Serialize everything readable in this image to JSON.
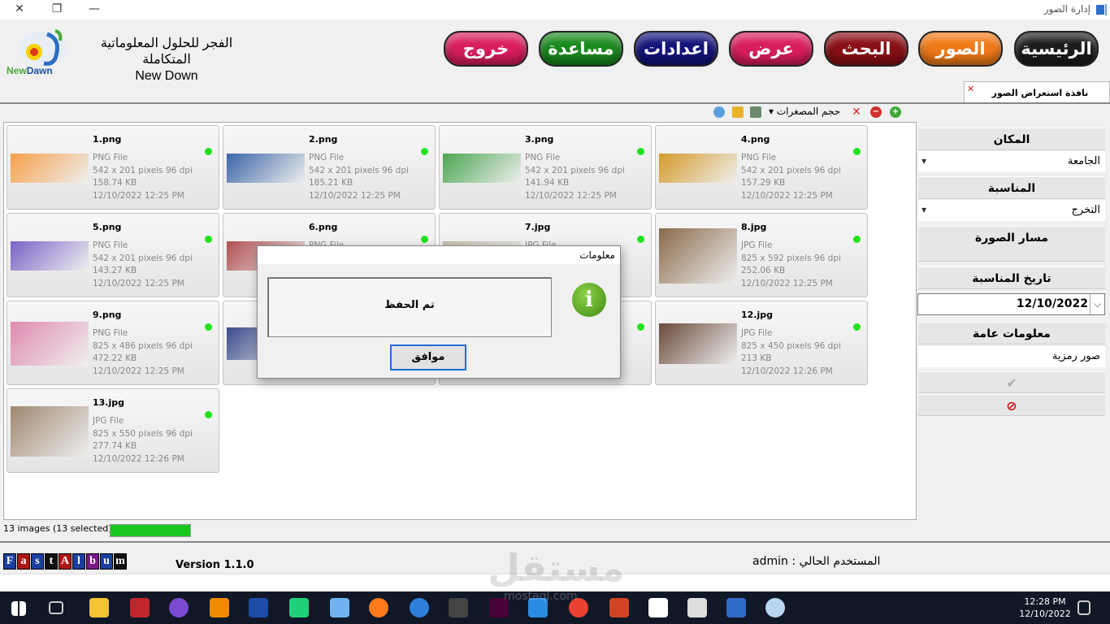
{
  "window": {
    "title": "إدارة الصور",
    "close": "✕",
    "restore": "❐",
    "minimize": "—"
  },
  "company": {
    "name_ar": "الفجر للحلول المعلوماتية المتكاملة",
    "name_en": "New Down",
    "logo_new": "New",
    "logo_dawn": "Dawn"
  },
  "nav": [
    {
      "label": "الرئيسية",
      "color": "#1c1c1c"
    },
    {
      "label": "الصور",
      "color": "#f07a18"
    },
    {
      "label": "البحث",
      "color": "#8a0f16"
    },
    {
      "label": "عرض",
      "color": "#d81e5b"
    },
    {
      "label": "اعدادات",
      "color": "#14147a"
    },
    {
      "label": "مساعدة",
      "color": "#1a8a1e"
    },
    {
      "label": "خروج",
      "color": "#d81e5b"
    }
  ],
  "tab": {
    "label": "نافذة استعراض الصور",
    "close": "✕"
  },
  "toolbar": {
    "thumb_size": "حجم المصغرات ▾",
    "add": "+",
    "remove": "−",
    "delete": "✕"
  },
  "images": [
    {
      "name": "1.png",
      "type": "PNG File",
      "dims": "542 x 201 pixels 96 dpi",
      "size": "158.74 KB",
      "date": "12/10/2022 12:25 PM"
    },
    {
      "name": "2.png",
      "type": "PNG File",
      "dims": "542 x 201 pixels 96 dpi",
      "size": "185.21 KB",
      "date": "12/10/2022 12:25 PM"
    },
    {
      "name": "3.png",
      "type": "PNG File",
      "dims": "542 x 201 pixels 96 dpi",
      "size": "141.94 KB",
      "date": "12/10/2022 12:25 PM"
    },
    {
      "name": "4.png",
      "type": "PNG File",
      "dims": "542 x 201 pixels 96 dpi",
      "size": "157.29 KB",
      "date": "12/10/2022 12:25 PM"
    },
    {
      "name": "5.png",
      "type": "PNG File",
      "dims": "542 x 201 pixels 96 dpi",
      "size": "143.27 KB",
      "date": "12/10/2022 12:25 PM"
    },
    {
      "name": "6.png",
      "type": "PNG File",
      "dims": "",
      "size": "",
      "date": ""
    },
    {
      "name": "7.jpg",
      "type": "JPG File",
      "dims": "",
      "size": "",
      "date": ""
    },
    {
      "name": "8.jpg",
      "type": "JPG File",
      "dims": "825 x 592 pixels 96 dpi",
      "size": "252.06 KB",
      "date": "12/10/2022 12:25 PM"
    },
    {
      "name": "9.png",
      "type": "PNG File",
      "dims": "825 x 486 pixels 96 dpi",
      "size": "472.22 KB",
      "date": "12/10/2022 12:25 PM"
    },
    {
      "name": "",
      "type": "",
      "dims": "",
      "size": "",
      "date": ""
    },
    {
      "name": "",
      "type": "",
      "dims": "",
      "size": "",
      "date": ""
    },
    {
      "name": "12.jpg",
      "type": "JPG File",
      "dims": "825 x 450 pixels 96 dpi",
      "size": "213 KB",
      "date": "12/10/2022 12:26 PM"
    },
    {
      "name": "13.jpg",
      "type": "JPG File",
      "dims": "825 x 550 pixels 96 dpi",
      "size": "277.74 KB",
      "date": "12/10/2022 12:26 PM"
    }
  ],
  "side": {
    "place_label": "المكان",
    "place_value": "الجامعة",
    "occasion_label": "المناسبة",
    "occasion_value": "التخرج",
    "path_label": "مسار الصورة",
    "date_label": "تاريخ المناسبة",
    "date_value": "12/10/2022",
    "info_label": "معلومات عامة",
    "info_value": "صور رمزية",
    "confirm": "✔",
    "cancel": "⦸"
  },
  "status": {
    "text": "13 images (13 selected)",
    "progress": 1.0
  },
  "footer": {
    "brand": [
      "F",
      "a",
      "s",
      "t",
      "A",
      "l",
      "b",
      "u",
      "m"
    ],
    "version": "Version 1.1.0",
    "user": "المستخدم الحالي :  admin"
  },
  "dialog": {
    "title": "معلومات",
    "message": "تم الحفظ",
    "ok": "موافق",
    "icon": "i"
  },
  "taskbar": {
    "time": "12:28 PM",
    "date": "12/10/2022"
  },
  "watermark": "مستقل",
  "watermark_site": "mostaql.com"
}
